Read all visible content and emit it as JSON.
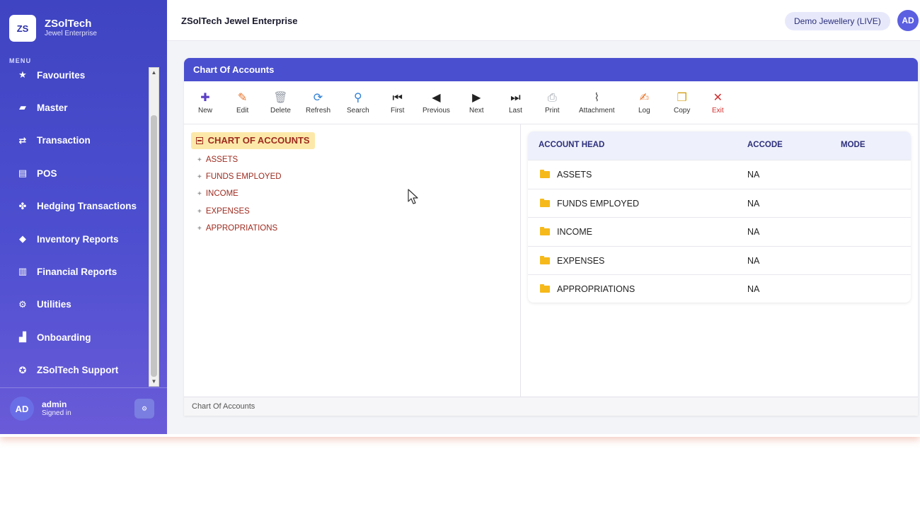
{
  "brand": {
    "logo": "ZS",
    "title": "ZSolTech",
    "subtitle": "Jewel Enterprise"
  },
  "sidebar": {
    "menu_label": "MENU",
    "items": [
      {
        "label": "Favourites",
        "icon": "star-icon",
        "glyph": "★"
      },
      {
        "label": "Master",
        "icon": "folder-icon",
        "glyph": "▰"
      },
      {
        "label": "Transaction",
        "icon": "transfer-icon",
        "glyph": "⇄"
      },
      {
        "label": "POS",
        "icon": "receipt-icon",
        "glyph": "▤"
      },
      {
        "label": "Hedging Transactions",
        "icon": "handshake-icon",
        "glyph": "✤"
      },
      {
        "label": "Inventory Reports",
        "icon": "box-icon",
        "glyph": "◆"
      },
      {
        "label": "Financial Reports",
        "icon": "bar-chart-icon",
        "glyph": "▥"
      },
      {
        "label": "Utilities",
        "icon": "gear-icon",
        "glyph": "⚙"
      },
      {
        "label": "Onboarding",
        "icon": "building-icon",
        "glyph": "▟"
      },
      {
        "label": "ZSolTech Support",
        "icon": "lifebuoy-icon",
        "glyph": "✪"
      }
    ],
    "user": {
      "initials": "AD",
      "name": "admin",
      "status": "Signed in"
    }
  },
  "header": {
    "title": "ZSolTech Jewel Enterprise",
    "company": "Demo Jewellery (LIVE)",
    "user_initials": "AD"
  },
  "panel": {
    "title": "Chart Of Accounts",
    "toolbar": [
      {
        "label": "New",
        "icon": "plus-icon",
        "glyph": "✚",
        "color": "#5b3fc4"
      },
      {
        "label": "Edit",
        "icon": "pencil-icon",
        "glyph": "✎",
        "color": "#e8742a"
      },
      {
        "label": "Delete",
        "icon": "trash-icon",
        "glyph": "🗑",
        "color": "#9aa0aa"
      },
      {
        "label": "Refresh",
        "icon": "refresh-icon",
        "glyph": "⟳",
        "color": "#2f7fd6"
      },
      {
        "label": "Search",
        "icon": "search-icon",
        "glyph": "⚲",
        "color": "#2f7fd6"
      },
      {
        "label": "First",
        "icon": "first-icon",
        "glyph": "⏮",
        "color": "#222222"
      },
      {
        "label": "Previous",
        "icon": "previous-icon",
        "glyph": "◀",
        "color": "#222222"
      },
      {
        "label": "Next",
        "icon": "next-icon",
        "glyph": "▶",
        "color": "#222222"
      },
      {
        "label": "Last",
        "icon": "last-icon",
        "glyph": "⏭",
        "color": "#222222"
      },
      {
        "label": "Print",
        "icon": "print-icon",
        "glyph": "⎙",
        "color": "#9aa0aa"
      },
      {
        "label": "Attachment",
        "icon": "paperclip-icon",
        "glyph": "⌇",
        "color": "#555555"
      },
      {
        "label": "Log",
        "icon": "log-icon",
        "glyph": "✍",
        "color": "#e8742a"
      },
      {
        "label": "Copy",
        "icon": "copy-icon",
        "glyph": "❐",
        "color": "#d4a017"
      },
      {
        "label": "Exit",
        "icon": "close-icon",
        "glyph": "✕",
        "color": "#d32f2f"
      }
    ],
    "tree": {
      "root": "CHART OF ACCOUNTS",
      "nodes": [
        "ASSETS",
        "FUNDS EMPLOYED",
        "INCOME",
        "EXPENSES",
        "APPROPRIATIONS"
      ]
    },
    "grid": {
      "columns": [
        "ACCOUNT HEAD",
        "ACCODE",
        "MODE"
      ],
      "rows": [
        {
          "head": "ASSETS",
          "accode": "NA",
          "mode": ""
        },
        {
          "head": "FUNDS EMPLOYED",
          "accode": "NA",
          "mode": ""
        },
        {
          "head": "INCOME",
          "accode": "NA",
          "mode": ""
        },
        {
          "head": "EXPENSES",
          "accode": "NA",
          "mode": ""
        },
        {
          "head": "APPROPRIATIONS",
          "accode": "NA",
          "mode": ""
        }
      ]
    },
    "footer": "Chart Of Accounts"
  },
  "colors": {
    "sidebar": "#4347c8",
    "panel_header": "#4a4fcf",
    "tree_text": "#9d2a1e",
    "tree_highlight": "#fce9a9",
    "folder": "#f6b91b"
  }
}
